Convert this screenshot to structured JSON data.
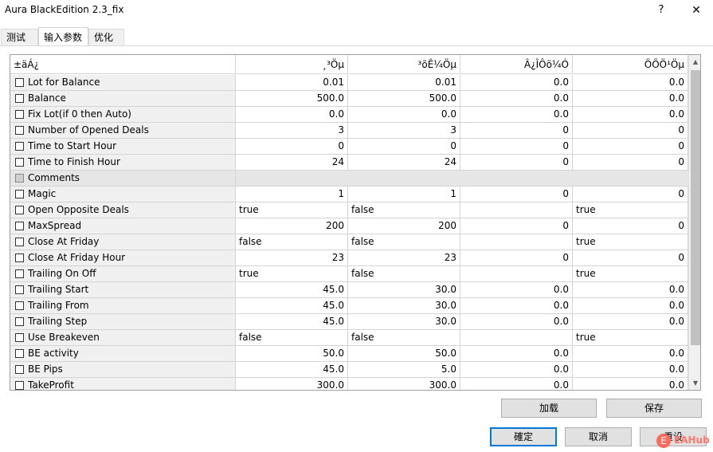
{
  "window": {
    "title": "Aura BlackEdition 2.3_fix",
    "help_label": "?",
    "close_label": "✕"
  },
  "tabs": [
    {
      "label": "测试"
    },
    {
      "label": "输入参数"
    },
    {
      "label": "优化"
    }
  ],
  "grid": {
    "headers": [
      "±äÁ¿",
      "¸³Öµ",
      "³õÊ¼Öµ",
      "Â¿ÎÔö¼Ó",
      "ÖÕÖ¹Öµ"
    ],
    "rows": [
      {
        "name": "Lot for Balance",
        "v1": "0.01",
        "v2": "0.01",
        "v3": "0.0",
        "v4": "0.0"
      },
      {
        "name": "Balance",
        "v1": "500.0",
        "v2": "500.0",
        "v3": "0.0",
        "v4": "0.0"
      },
      {
        "name": "Fix Lot(if 0 then Auto)",
        "v1": "0.0",
        "v2": "0.0",
        "v3": "0.0",
        "v4": "0.0"
      },
      {
        "name": "Number of Opened Deals",
        "v1": "3",
        "v2": "3",
        "v3": "0",
        "v4": "0"
      },
      {
        "name": "Time to Start Hour",
        "v1": "0",
        "v2": "0",
        "v3": "0",
        "v4": "0"
      },
      {
        "name": "Time to Finish Hour",
        "v1": "24",
        "v2": "24",
        "v3": "0",
        "v4": "0"
      },
      {
        "name": "Comments",
        "section": true
      },
      {
        "name": "Magic",
        "v1": "1",
        "v2": "1",
        "v3": "0",
        "v4": "0"
      },
      {
        "name": "Open Opposite Deals",
        "v1": "true",
        "v2": "false",
        "v3": "",
        "v4": "true",
        "text": true
      },
      {
        "name": "MaxSpread",
        "v1": "200",
        "v2": "200",
        "v3": "0",
        "v4": "0"
      },
      {
        "name": "Close At Friday",
        "v1": "false",
        "v2": "false",
        "v3": "",
        "v4": "true",
        "text": true
      },
      {
        "name": "Close At Friday Hour",
        "v1": "23",
        "v2": "23",
        "v3": "0",
        "v4": "0"
      },
      {
        "name": "Trailing On Off",
        "v1": "true",
        "v2": "false",
        "v3": "",
        "v4": "true",
        "text": true
      },
      {
        "name": "Trailing Start",
        "v1": "45.0",
        "v2": "30.0",
        "v3": "0.0",
        "v4": "0.0"
      },
      {
        "name": "Trailing From",
        "v1": "45.0",
        "v2": "30.0",
        "v3": "0.0",
        "v4": "0.0"
      },
      {
        "name": "Trailing Step",
        "v1": "45.0",
        "v2": "30.0",
        "v3": "0.0",
        "v4": "0.0"
      },
      {
        "name": "Use Breakeven",
        "v1": "false",
        "v2": "false",
        "v3": "",
        "v4": "true",
        "text": true
      },
      {
        "name": "BE activity",
        "v1": "50.0",
        "v2": "50.0",
        "v3": "0.0",
        "v4": "0.0"
      },
      {
        "name": "BE Pips",
        "v1": "45.0",
        "v2": "5.0",
        "v3": "0.0",
        "v4": "0.0"
      },
      {
        "name": "TakeProfit",
        "v1": "300.0",
        "v2": "300.0",
        "v3": "0.0",
        "v4": "0.0"
      }
    ]
  },
  "buttons": {
    "load": "加载",
    "save": "保存",
    "ok": "確定",
    "cancel": "取消",
    "reset": "重设"
  },
  "watermark": {
    "logo": "E",
    "text": "EAHub"
  }
}
